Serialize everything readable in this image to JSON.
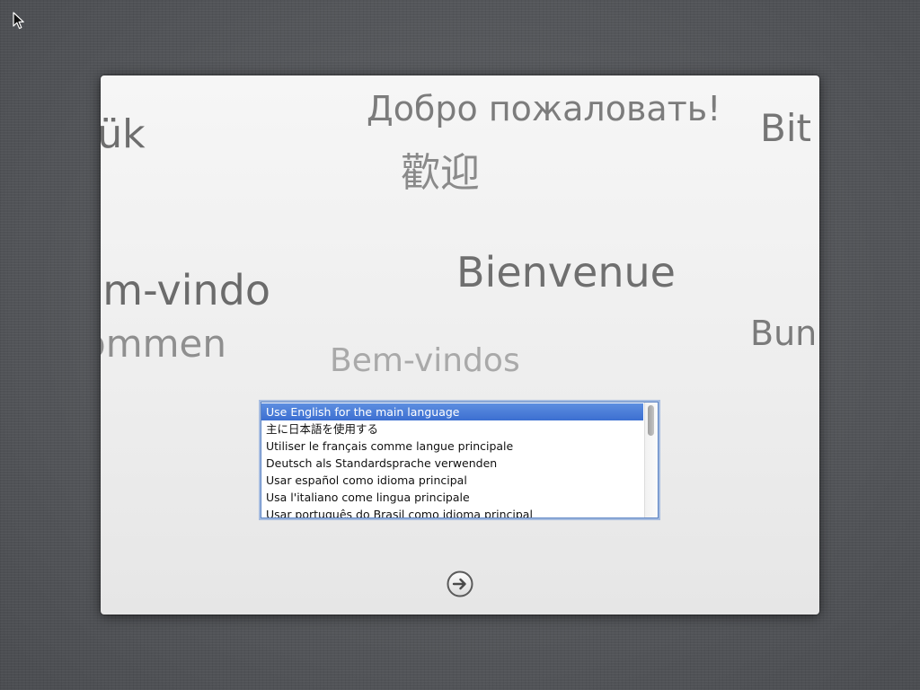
{
  "greetings": {
    "russian": "Добро пожаловать!",
    "chinese": "歡迎",
    "hungarian": "jük",
    "vietnamese": "Bit",
    "french": "Bienvenue",
    "portuguese_pt": "em-vindo",
    "german": "ommen",
    "romanian": "Bun",
    "portuguese_br": "Bem-vindos"
  },
  "language_list": {
    "items": [
      "Use English for the main language",
      "主に日本語を使用する",
      "Utiliser le français comme langue principale",
      "Deutsch als Standardsprache verwenden",
      "Usar español como idioma principal",
      "Usa l'italiano come lingua principale",
      "Usar português do Brasil como idioma principal"
    ],
    "selected_index": 0
  },
  "icons": {
    "cursor": "arrow-pointer-icon",
    "continue": "arrow-right-circle-icon"
  },
  "colors": {
    "selection": "#3d6fd1",
    "panel": "#f0f0f0",
    "background": "#55575b"
  }
}
